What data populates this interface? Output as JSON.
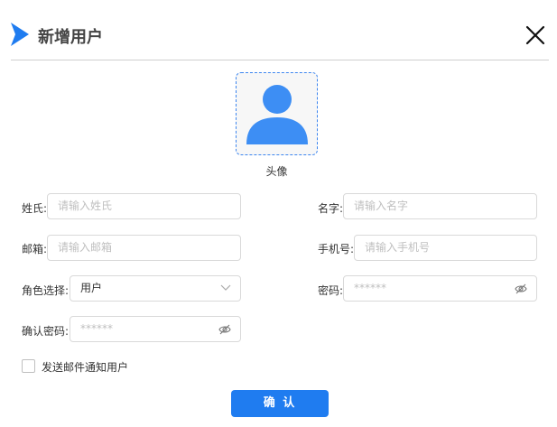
{
  "dialog": {
    "title": "新增用户",
    "accent_color": "#1f7cf0",
    "logo_icon": "play-chevron-icon",
    "close_icon": "close-x-icon"
  },
  "avatar": {
    "label": "头像",
    "icon": "user-silhouette-icon",
    "icon_color": "#3d8ef4"
  },
  "form": {
    "last_name": {
      "label": "姓氏:",
      "placeholder": "请输入姓氏"
    },
    "first_name": {
      "label": "名字:",
      "placeholder": "请输入名字"
    },
    "email": {
      "label": "邮箱:",
      "placeholder": "请输入邮箱"
    },
    "phone": {
      "label": "手机号:",
      "placeholder": "请输入手机号"
    },
    "role": {
      "label": "角色选择:",
      "value": "用户",
      "icon": "chevron-down-icon"
    },
    "password": {
      "label": "密码:",
      "placeholder": "******",
      "icon": "eye-off-icon"
    },
    "confirm_password": {
      "label": "确认密码:",
      "placeholder": "******",
      "icon": "eye-off-icon"
    },
    "notify": {
      "label": "发送邮件通知用户",
      "checked": false
    }
  },
  "actions": {
    "confirm_label": "确 认"
  }
}
